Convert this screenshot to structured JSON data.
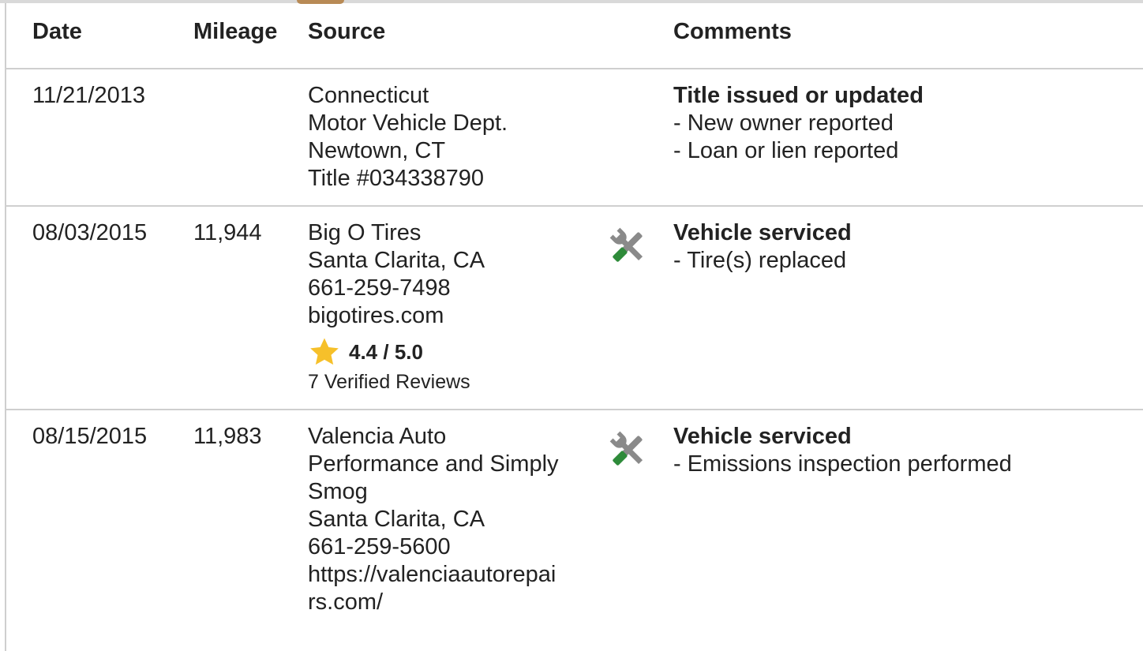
{
  "columns": {
    "date": "Date",
    "mileage": "Mileage",
    "source": "Source",
    "comments": "Comments"
  },
  "records": [
    {
      "date": "11/21/2013",
      "mileage": "",
      "source": [
        "Connecticut",
        "Motor Vehicle Dept.",
        "Newtown, CT",
        "Title #034338790"
      ],
      "icon": null,
      "comment_title": "Title issued or updated",
      "comment_items": [
        "- New owner reported",
        "- Loan or lien reported"
      ]
    },
    {
      "date": "08/03/2015",
      "mileage": "11,944",
      "source": [
        "Big O Tires",
        "Santa Clarita, CA",
        "661-259-7498",
        "bigotires.com"
      ],
      "rating": "4.4 / 5.0",
      "reviews": "7 Verified Reviews",
      "icon": "service-tools-icon",
      "comment_title": "Vehicle serviced",
      "comment_items": [
        "- Tire(s) replaced"
      ]
    },
    {
      "date": "08/15/2015",
      "mileage": "11,983",
      "source": [
        "Valencia Auto",
        "Performance and Simply",
        "Smog",
        "Santa Clarita, CA",
        "661-259-5600",
        "https://valenciaautorepai",
        "rs.com/"
      ],
      "icon": "service-tools-icon",
      "comment_title": "Vehicle serviced",
      "comment_items": [
        "- Emissions inspection performed"
      ]
    }
  ],
  "colors": {
    "star": "#f6c02a",
    "wrench": "#8a8a8a",
    "screwdriver_handle": "#2e8b3a",
    "border": "#cfcfcf"
  }
}
